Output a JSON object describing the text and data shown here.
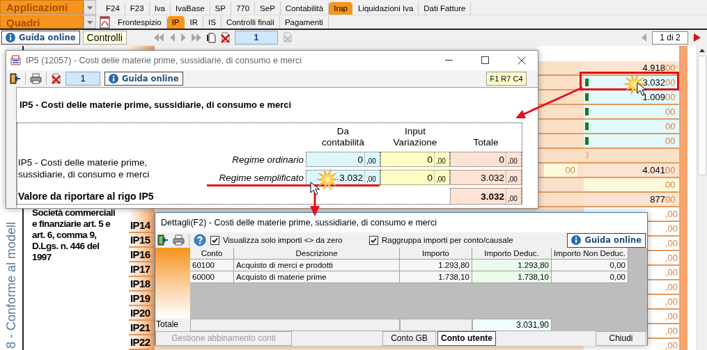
{
  "selectors": [
    {
      "label": "Applicazioni"
    },
    {
      "label": "Quadri"
    }
  ],
  "module_tabs": [
    {
      "label": "F24",
      "selected": false
    },
    {
      "label": "F23",
      "selected": false
    },
    {
      "label": "Iva",
      "selected": false
    },
    {
      "label": "IvaBase",
      "selected": false
    },
    {
      "label": "SP",
      "selected": false
    },
    {
      "label": "770",
      "selected": false
    },
    {
      "label": "SeP",
      "selected": false
    },
    {
      "label": "Contabilità",
      "selected": false
    },
    {
      "label": "Irap",
      "selected": true
    },
    {
      "label": "Liquidazioni Iva",
      "selected": false
    },
    {
      "label": "Dati Fatture",
      "selected": false
    }
  ],
  "section_tabs": [
    {
      "label": "Frontespizio",
      "selected": false
    },
    {
      "label": "IP",
      "selected": true
    },
    {
      "label": "IR",
      "selected": false
    },
    {
      "label": "IS",
      "selected": false
    },
    {
      "label": "Controlli finali",
      "selected": false
    },
    {
      "label": "Pagamenti",
      "selected": false
    }
  ],
  "toolbar": {
    "help_button": "Guida online",
    "checks_button": "Controlli",
    "page_field": "1",
    "pager": "1 di 2"
  },
  "form": {
    "side_caption": "8 - Conforme al modell",
    "note": "Società commerciali e finanziarie art. 5 e art. 6, comma 9, D.Lgs. n. 446 del 1997",
    "row_codes": [
      "IP14",
      "IP15",
      "IP16",
      "IP17",
      "IP18",
      "IP19",
      "IP20",
      "IP21",
      "IP22"
    ],
    "amounts": [
      {
        "kind": "amount",
        "value": "4.918",
        "decimals": "00",
        "color": "#fde3d1",
        "marked": false,
        "highlighted": false
      },
      {
        "kind": "amount",
        "value": "3.032",
        "decimals": "00",
        "color": "#e3f9fc",
        "marked": true,
        "highlighted": true
      },
      {
        "kind": "amount",
        "value": "1.009",
        "decimals": "00",
        "color": "#e3f9fc",
        "marked": true,
        "highlighted": false
      },
      {
        "kind": "amount",
        "decimals": "00",
        "color": "#e3f9fc",
        "marked": true,
        "highlighted": false
      },
      {
        "kind": "amount",
        "decimals": "00",
        "color": "#e3f9fc",
        "marked": true,
        "highlighted": false
      },
      {
        "kind": "amount",
        "decimals": "00",
        "color": "#e3f9fc",
        "marked": true,
        "highlighted": false
      },
      {
        "kind": "note",
        "value": "3"
      },
      {
        "kind": "amount",
        "value": "4.041",
        "decimals": "00",
        "color": "#fde3d1",
        "marked": false,
        "highlighted": false,
        "side_field": "00"
      },
      {
        "kind": "amount",
        "decimals": "00",
        "color": "#fff9dc",
        "marked": false,
        "highlighted": false
      },
      {
        "kind": "amount",
        "value": "877",
        "decimals": "00",
        "color": "#fde3d1",
        "marked": false,
        "highlighted": false
      },
      {
        "kind": "amount",
        "decimals": ",00",
        "color": "#ffffff",
        "marked": false,
        "highlighted": false
      },
      {
        "kind": "amount",
        "decimals": ",00",
        "color": "#ffffff",
        "marked": false,
        "highlighted": false
      },
      {
        "kind": "amount",
        "decimals": ",00",
        "color": "#ffffff",
        "marked": false,
        "highlighted": false
      },
      {
        "kind": "amount",
        "decimals": ",00",
        "color": "#ffffff",
        "marked": false,
        "highlighted": false
      },
      {
        "kind": "amount",
        "decimals": ",00",
        "color": "#ffffff",
        "marked": false,
        "highlighted": false
      },
      {
        "kind": "amount",
        "decimals": ",00",
        "color": "#ffffff",
        "marked": false,
        "highlighted": false
      },
      {
        "kind": "amount",
        "decimals": ",00",
        "color": "#ffffff",
        "marked": false,
        "highlighted": false
      },
      {
        "kind": "amount",
        "decimals": ",00",
        "color": "#ffffff",
        "marked": false,
        "highlighted": false
      },
      {
        "kind": "amount",
        "decimals": ",00",
        "color": "#ffffff",
        "marked": false,
        "highlighted": false
      },
      {
        "kind": "amount",
        "decimals": ",00",
        "color": "#ffffff",
        "marked": false,
        "highlighted": false
      }
    ]
  },
  "ip5_window": {
    "title": "IP5 (12057) - Costi delle materie prime, sussidiarie, di consumo e merci",
    "page_field": "1",
    "help_button": "Guida online",
    "cell_ref": "F1 R7 C4",
    "heading": "IP5 - Costi delle materie prime, sussidiarie, di consumo e merci",
    "columns": [
      "Da contabilità",
      "Input Variazione",
      "Totale"
    ],
    "description": "IP5 - Costi delle materie prime, sussidiarie, di consumo e merci",
    "rows": [
      {
        "label": "Regime ordinario",
        "values": [
          {
            "value": "0",
            "decimals": ",00"
          },
          {
            "value": "0",
            "decimals": ",00"
          },
          {
            "value": "0",
            "decimals": ",00"
          }
        ]
      },
      {
        "label": "Regime semplificato",
        "values": [
          {
            "value": "3.032",
            "decimals": ",00"
          },
          {
            "value": "0",
            "decimals": ",00"
          },
          {
            "value": "3.032",
            "decimals": ",00"
          }
        ]
      }
    ],
    "total": {
      "label": "Valore da riportare al rigo IP5",
      "value": "3.032",
      "decimals": ",00"
    }
  },
  "details_window": {
    "title": "Dettagli(F2) - Costi delle materie prime, sussidiarie, di consumo e merci",
    "options": [
      {
        "label": "Visualizza solo importi <> da zero",
        "checked": true
      },
      {
        "label": "Raggruppa importi per conto/causale",
        "checked": true
      }
    ],
    "help_button": "Guida online",
    "columns": [
      "Conto",
      "Descrizione",
      "Importo",
      "Importo Deduc.",
      "Importo Non Deduc."
    ],
    "rows": [
      [
        "60100",
        "Acquisto di merci e prodotti",
        "1.293,80",
        "1.293,80",
        "0,00"
      ],
      [
        "60000",
        "Acquisto di materie prime",
        "1.738,10",
        "1.738,10",
        "0,00"
      ]
    ],
    "total_label": "Totale",
    "total_deductible": "3.031,90",
    "mapping_button": {
      "label": "Gestione abbinamento conti",
      "disabled": true
    },
    "account_views": [
      {
        "label": "Conto GB",
        "selected": false
      },
      {
        "label": "Conto utente",
        "selected": true
      }
    ],
    "close_button": "Chiudi"
  }
}
